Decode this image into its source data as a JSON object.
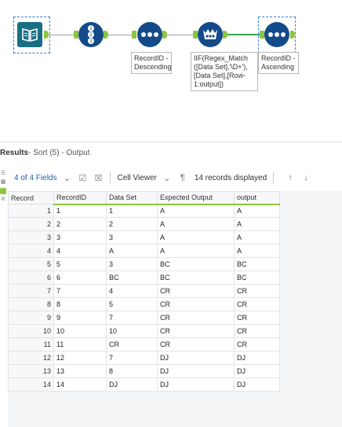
{
  "workflow": {
    "annotations": {
      "sort_desc": "RecordID -\nDescending",
      "formula": "IIF(Regex_Match\n([Data Set],'\\D+'),\n[Data Set],[Row-\n1:output])",
      "sort_asc": "RecordID -\nAscending"
    },
    "colors": {
      "tool_navy": "#134a8a",
      "tool_teal": "#1a6f82",
      "anchor": "#8cc63e",
      "wire_active": "#3aa35a",
      "selection": "#3a7bd5"
    },
    "icons": [
      "book-input-icon",
      "record-id-icon",
      "sort-icon",
      "multi-row-formula-icon",
      "sort-icon"
    ]
  },
  "results": {
    "header_prefix": "Results",
    "header_suffix": " - Sort (5) - Output",
    "fields_label": "4 of 4 Fields",
    "cell_viewer_label": "Cell Viewer",
    "records_displayed": "14 records displayed",
    "columns": [
      "Record",
      "RecordID",
      "Data Set",
      "Expected Output",
      "output"
    ],
    "rows": [
      [
        "1",
        "1",
        "1",
        "A",
        "A"
      ],
      [
        "2",
        "2",
        "2",
        "A",
        "A"
      ],
      [
        "3",
        "3",
        "3",
        "A",
        "A"
      ],
      [
        "4",
        "4",
        "A",
        "A",
        "A"
      ],
      [
        "5",
        "5",
        "3",
        "BC",
        "BC"
      ],
      [
        "6",
        "6",
        "BC",
        "BC",
        "BC"
      ],
      [
        "7",
        "7",
        "4",
        "CR",
        "CR"
      ],
      [
        "8",
        "8",
        "5",
        "CR",
        "CR"
      ],
      [
        "9",
        "9",
        "7",
        "CR",
        "CR"
      ],
      [
        "10",
        "10",
        "10",
        "CR",
        "CR"
      ],
      [
        "11",
        "11",
        "CR",
        "CR",
        "CR"
      ],
      [
        "12",
        "12",
        "7",
        "DJ",
        "DJ"
      ],
      [
        "13",
        "13",
        "8",
        "DJ",
        "DJ"
      ],
      [
        "14",
        "14",
        "DJ",
        "DJ",
        "DJ"
      ]
    ]
  }
}
